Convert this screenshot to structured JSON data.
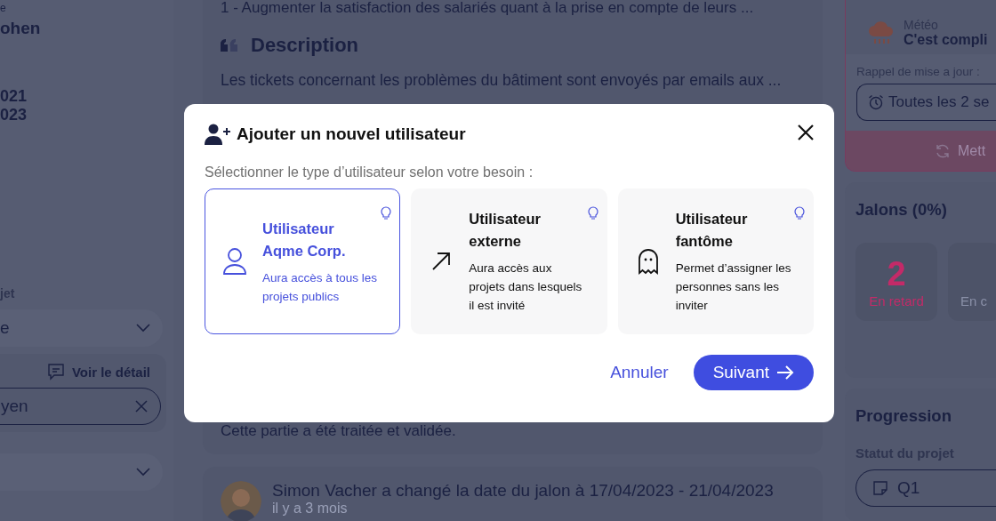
{
  "sidebar": {
    "header_fragments": [
      "e",
      "ohen"
    ],
    "date_fragments": [
      "021",
      "023"
    ],
    "section_label": "jet",
    "project_select": {
      "value": "e"
    },
    "detail_link": "Voir le détail",
    "person_field": {
      "value": "yen"
    }
  },
  "main": {
    "objective_line": "1 - Augmenter la satisfaction des salariés quant à la prise en compte de leurs ...",
    "description": {
      "heading": "Description",
      "text": "Les tickets concernant les problèmes du bâtiment sont envoyés par emails aux ..."
    },
    "validated_note": "Cette partie a été traitée et validée.",
    "activity": {
      "text": "Simon Vacher a changé la date du jalon à 17/04/2023 - 21/04/2023",
      "time": "il y a 3 mois"
    }
  },
  "right_panel": {
    "weather": {
      "label": "Météo",
      "value": "C'est compli"
    },
    "reminder_label": "Rappel de mise a jour :",
    "reminder_value": "Toutes les 2 se",
    "update_button": "Mett",
    "milestones": {
      "title": "Jalons (0%)",
      "tiles": [
        {
          "count": "2",
          "label": "En retard",
          "kind": "late"
        },
        {
          "label": "En c",
          "kind": "neutral"
        }
      ]
    },
    "progression": {
      "title": "Progression",
      "status_label": "Statut du projet",
      "status_value": "Q1"
    }
  },
  "dialog": {
    "title": "Ajouter un nouvel utilisateur",
    "prompt": "Sélectionner le type d’utilisateur selon votre besoin :",
    "options": [
      {
        "kind": "member",
        "title": "Utilisateur Aqme Corp.",
        "description": "Aura accès à tous les projets publics",
        "selected": true
      },
      {
        "kind": "external",
        "title": "Utilisateur externe",
        "description": "Aura accès aux projets dans lesquels il est invité",
        "selected": false
      },
      {
        "kind": "ghost",
        "title": "Utilisateur fantôme",
        "description": "Permet d’assigner les personnes sans les inviter",
        "selected": false
      }
    ],
    "cancel_button": "Annuler",
    "next_button": "Suivant"
  }
}
